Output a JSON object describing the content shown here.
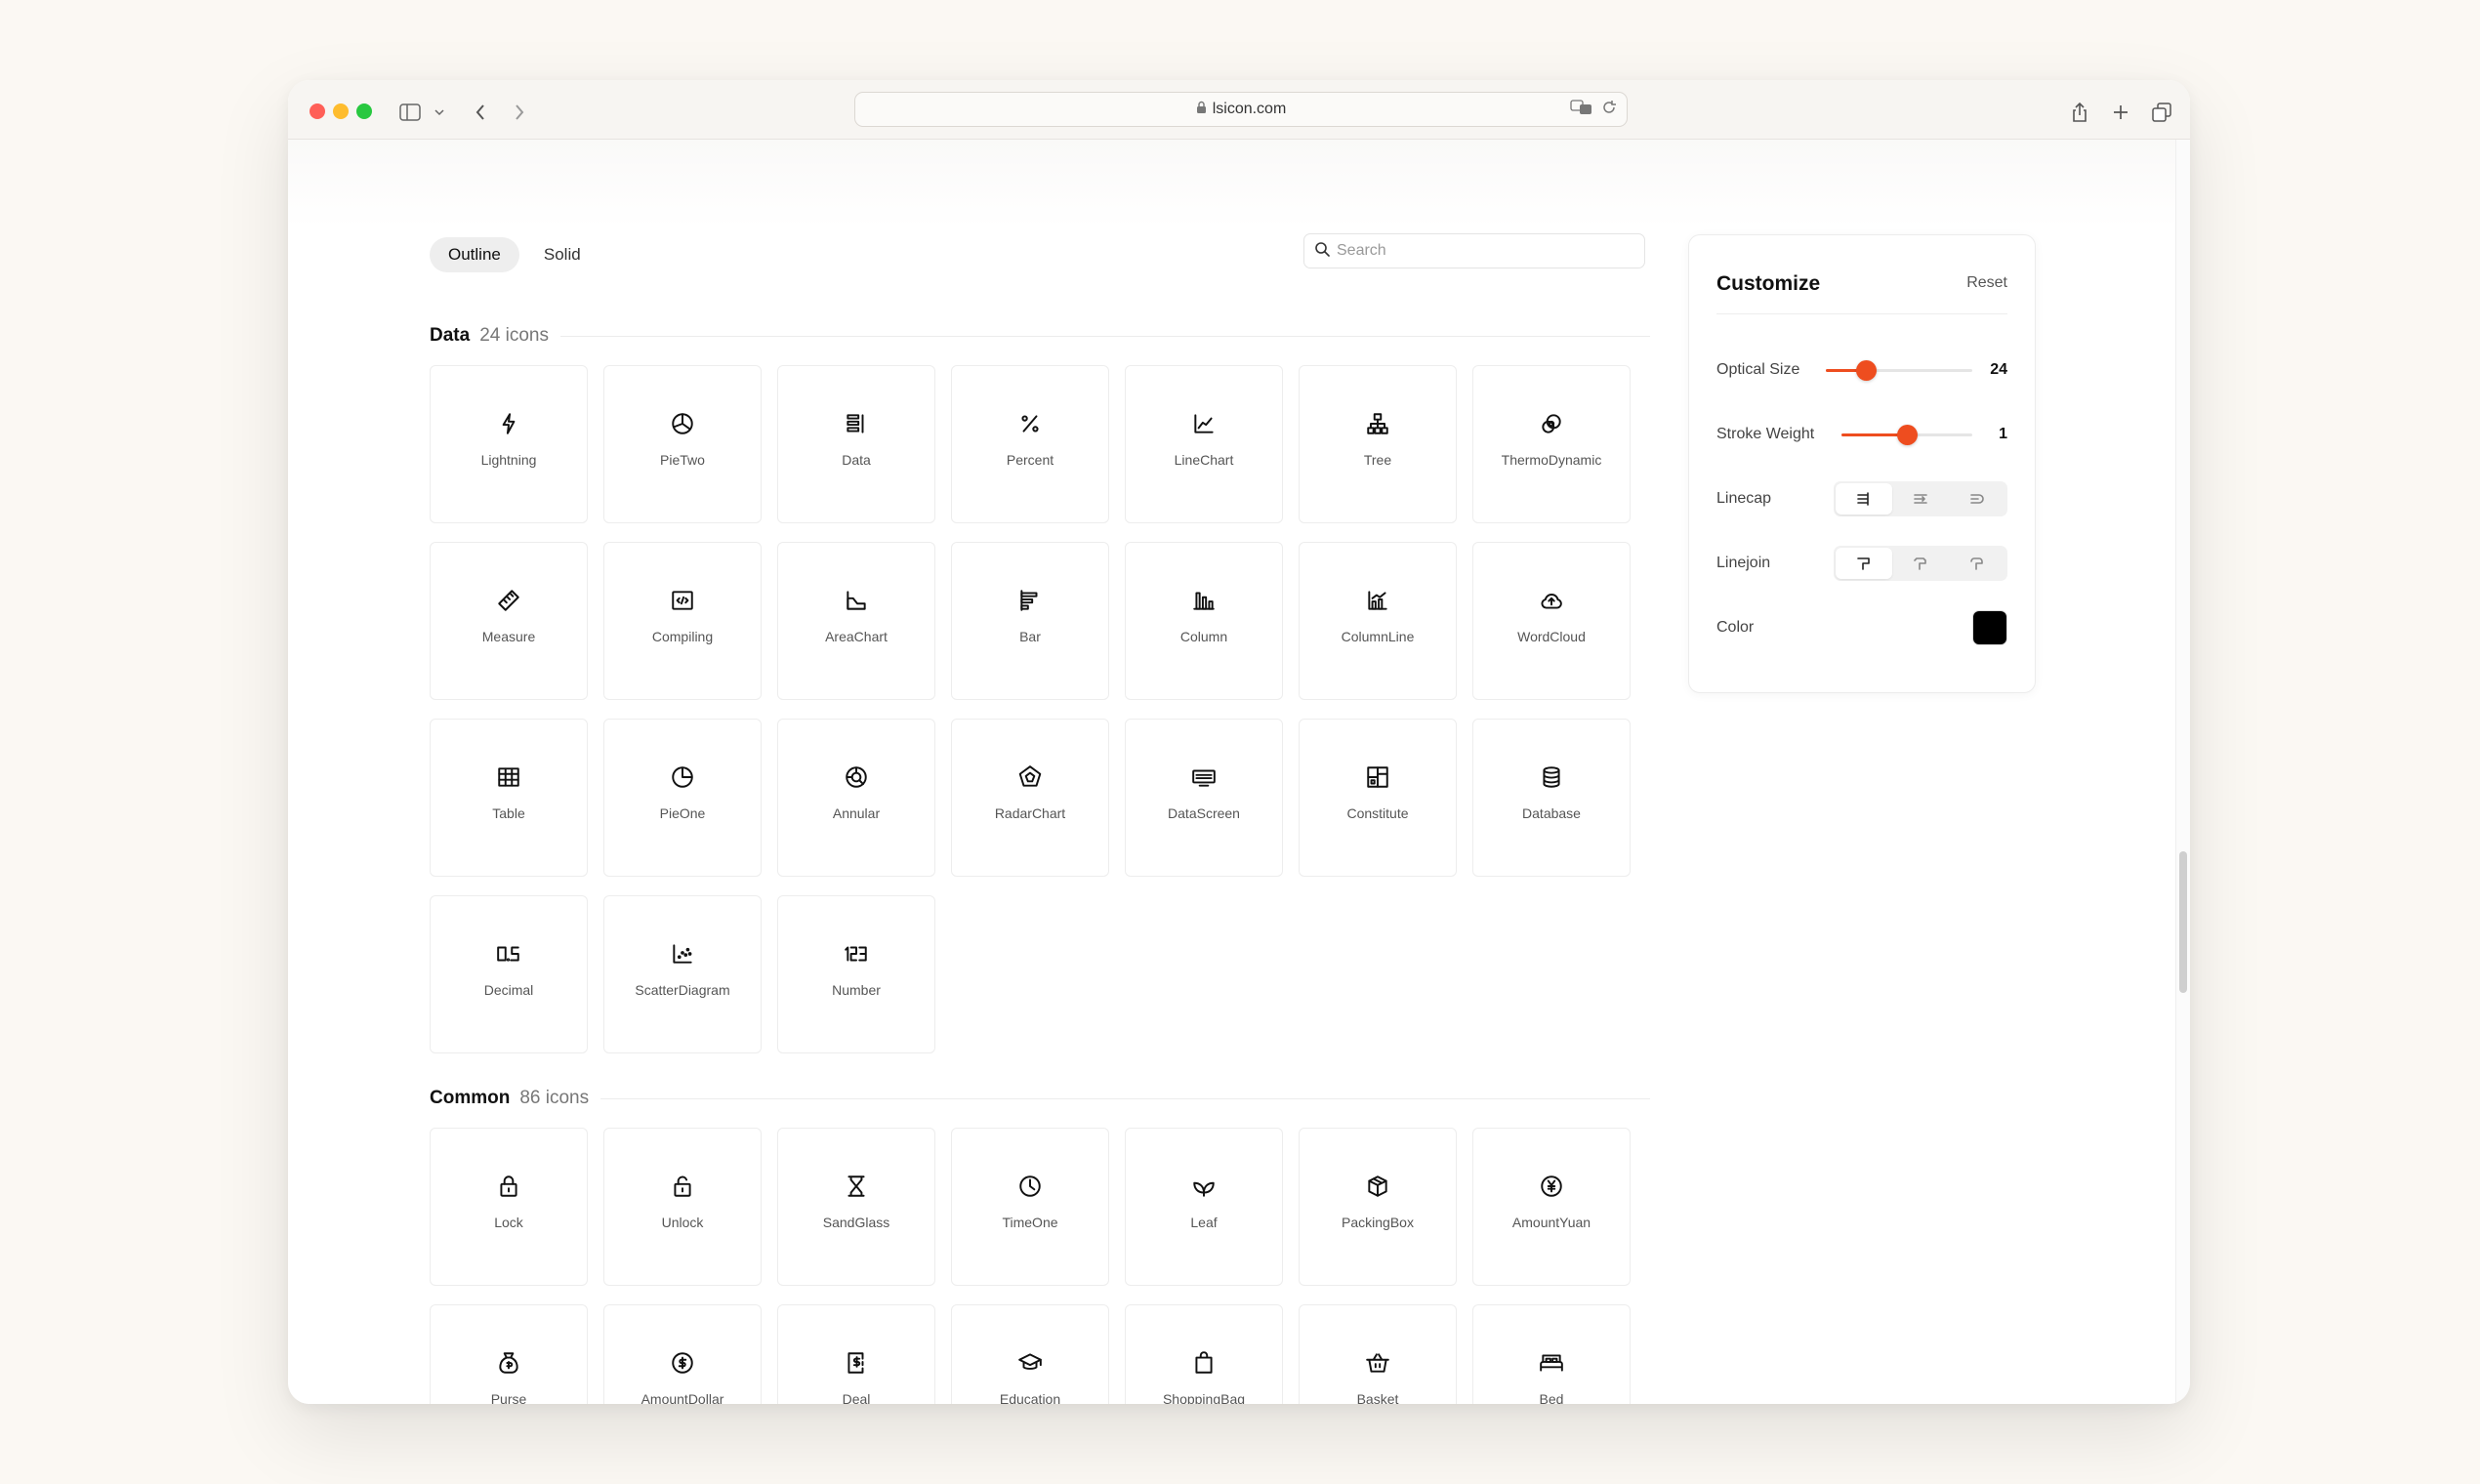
{
  "browser": {
    "url": "lsicon.com"
  },
  "tabs": [
    {
      "label": "Outline",
      "active": true
    },
    {
      "label": "Solid",
      "active": false
    }
  ],
  "search": {
    "placeholder": "Search"
  },
  "sections": [
    {
      "title": "Data",
      "count": "24 icons",
      "items": [
        {
          "label": "Lightning",
          "icon": "lightning-icon"
        },
        {
          "label": "PieTwo",
          "icon": "pie-two-icon"
        },
        {
          "label": "Data",
          "icon": "data-icon"
        },
        {
          "label": "Percent",
          "icon": "percent-icon"
        },
        {
          "label": "LineChart",
          "icon": "line-chart-icon"
        },
        {
          "label": "Tree",
          "icon": "tree-icon"
        },
        {
          "label": "ThermoDynamic",
          "icon": "thermo-dynamic-icon"
        },
        {
          "label": "Measure",
          "icon": "measure-icon"
        },
        {
          "label": "Compiling",
          "icon": "compiling-icon"
        },
        {
          "label": "AreaChart",
          "icon": "area-chart-icon"
        },
        {
          "label": "Bar",
          "icon": "bar-icon"
        },
        {
          "label": "Column",
          "icon": "column-icon"
        },
        {
          "label": "ColumnLine",
          "icon": "column-line-icon"
        },
        {
          "label": "WordCloud",
          "icon": "word-cloud-icon"
        },
        {
          "label": "Table",
          "icon": "table-icon"
        },
        {
          "label": "PieOne",
          "icon": "pie-one-icon"
        },
        {
          "label": "Annular",
          "icon": "annular-icon"
        },
        {
          "label": "RadarChart",
          "icon": "radar-chart-icon"
        },
        {
          "label": "DataScreen",
          "icon": "data-screen-icon"
        },
        {
          "label": "Constitute",
          "icon": "constitute-icon"
        },
        {
          "label": "Database",
          "icon": "database-icon"
        },
        {
          "label": "Decimal",
          "icon": "decimal-icon"
        },
        {
          "label": "ScatterDiagram",
          "icon": "scatter-diagram-icon"
        },
        {
          "label": "Number",
          "icon": "number-icon"
        }
      ]
    },
    {
      "title": "Common",
      "count": "86 icons",
      "items": [
        {
          "label": "Lock",
          "icon": "lock-icon"
        },
        {
          "label": "Unlock",
          "icon": "unlock-icon"
        },
        {
          "label": "SandGlass",
          "icon": "sand-glass-icon"
        },
        {
          "label": "TimeOne",
          "icon": "time-one-icon"
        },
        {
          "label": "Leaf",
          "icon": "leaf-icon"
        },
        {
          "label": "PackingBox",
          "icon": "packing-box-icon"
        },
        {
          "label": "AmountYuan",
          "icon": "amount-yuan-icon"
        },
        {
          "label": "Purse",
          "icon": "purse-icon"
        },
        {
          "label": "AmountDollar",
          "icon": "amount-dollar-icon"
        },
        {
          "label": "Deal",
          "icon": "deal-icon"
        },
        {
          "label": "Education",
          "icon": "education-icon"
        },
        {
          "label": "ShoppingBag",
          "icon": "shopping-bag-icon"
        },
        {
          "label": "Basket",
          "icon": "basket-icon"
        },
        {
          "label": "Bed",
          "icon": "bed-icon"
        }
      ]
    }
  ],
  "customize": {
    "title": "Customize",
    "reset": "Reset",
    "optical_size": {
      "label": "Optical Size",
      "value": "24",
      "fraction": 0.27
    },
    "stroke_weight": {
      "label": "Stroke Weight",
      "value": "1",
      "fraction": 0.5
    },
    "linecap": {
      "label": "Linecap",
      "options": [
        "butt-cap-icon",
        "square-cap-icon",
        "round-cap-icon"
      ],
      "active": 0
    },
    "linejoin": {
      "label": "Linejoin",
      "options": [
        "miter-join-icon",
        "bevel-join-icon",
        "round-join-icon"
      ],
      "active": 0
    },
    "color": {
      "label": "Color",
      "value": "#000000"
    },
    "accent": "#ee4d1f"
  }
}
